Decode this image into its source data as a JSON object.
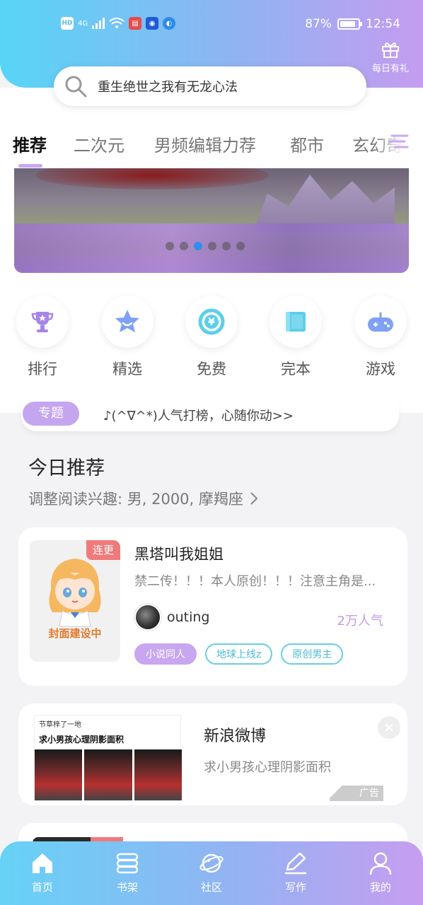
{
  "status_bar": {
    "left_badges": [
      "HD",
      "4G"
    ],
    "battery": "87%",
    "battery_level": 0.87,
    "time": "12:54"
  },
  "header": {
    "gift_label": "每日有礼",
    "search_placeholder": "重生绝世之我有无龙心法"
  },
  "tabs": [
    {
      "label": "推荐",
      "active": true
    },
    {
      "label": "二次元",
      "active": false
    },
    {
      "label": "男频编辑力荐",
      "active": false
    },
    {
      "label": "都市",
      "active": false
    },
    {
      "label": "玄幻奇幻",
      "active": false
    }
  ],
  "banner": {
    "dots": 6,
    "active_dot": 3
  },
  "quick_entries": [
    {
      "label": "排行",
      "icon": "trophy-icon"
    },
    {
      "label": "精选",
      "icon": "star-icon"
    },
    {
      "label": "免费",
      "icon": "free-yuan-icon"
    },
    {
      "label": "完本",
      "icon": "book-icon"
    },
    {
      "label": "游戏",
      "icon": "gamepad-icon"
    }
  ],
  "topic": {
    "tag": "专题",
    "text": "♪(^∇^*)人气打榜，心随你动>>"
  },
  "today": {
    "title": "今日推荐",
    "subtitle": "调整阅读兴趣: 男, 2000, 摩羯座"
  },
  "book": {
    "badge": "连更",
    "cover_text": "封面建设中",
    "title": "黑塔叫我姐姐",
    "desc": "禁二传！！！本人原创！！！注意主角是...",
    "author": "outing",
    "popularity": "2万人气",
    "tags": [
      "小说同人",
      "地球上线z",
      "原创男主"
    ]
  },
  "ad": {
    "img_head": "节草梓了一地",
    "img_title": "求小男孩心理阴影面积",
    "title": "新浪微博",
    "desc": "求小男孩心理阴影面积",
    "label": "广告"
  },
  "bottom_nav": [
    {
      "label": "首页",
      "icon": "home-icon",
      "active": true
    },
    {
      "label": "书架",
      "icon": "bookshelf-icon",
      "active": false
    },
    {
      "label": "社区",
      "icon": "planet-icon",
      "active": false
    },
    {
      "label": "写作",
      "icon": "write-icon",
      "active": false
    },
    {
      "label": "我的",
      "icon": "profile-icon",
      "active": false
    }
  ],
  "colors": {
    "accent_purple": "#c4a6ef",
    "accent_cyan": "#57d5f6",
    "tag_cyan": "#67cfe0",
    "badge_red": "#f07a7a"
  }
}
